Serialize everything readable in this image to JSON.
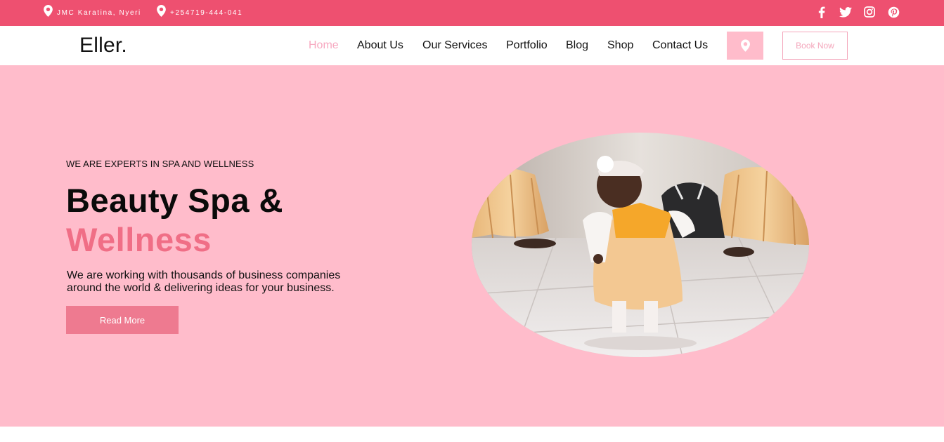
{
  "topbar": {
    "address": "JMC Karatina, Nyeri",
    "phone": "+254719-444-041",
    "social": [
      "facebook-icon",
      "twitter-icon",
      "instagram-icon",
      "pinterest-icon"
    ]
  },
  "nav": {
    "brand": "Eller.",
    "items": [
      "Home",
      "About Us",
      "Our Services",
      "Portfolio",
      "Blog",
      "Shop",
      "Contact Us"
    ],
    "active": "Home",
    "book_label": "Book Now"
  },
  "hero": {
    "eyebrow": "WE ARE EXPERTS IN SPA AND WELLNESS",
    "title_line1": "Beauty Spa &",
    "title_line2": "Wellness",
    "description": "We are working with thousands of business companies around the world & delivering ideas for your business.",
    "button_label": "Read More"
  },
  "colors": {
    "topbar": "#ee5070",
    "hero_bg": "#ffbccb",
    "accent": "#f06e86",
    "button": "#ee7a90",
    "nav_active": "#f7a8c0"
  }
}
